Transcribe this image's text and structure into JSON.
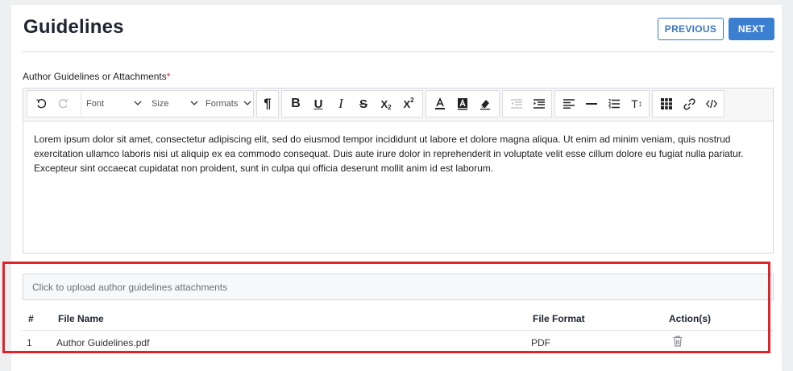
{
  "page": {
    "title": "Guidelines"
  },
  "nav": {
    "previous_label": "PREVIOUS",
    "next_label": "NEXT"
  },
  "field": {
    "label": "Author Guidelines or Attachments",
    "required_mark": "*"
  },
  "toolbar": {
    "font_select": "Font",
    "size_select": "Size",
    "formats_select": "Formats",
    "icons": [
      "undo-icon",
      "redo-icon",
      "paragraph-icon",
      "bold-icon",
      "underline-icon",
      "italic-icon",
      "strikethrough-icon",
      "subscript-icon",
      "superscript-icon",
      "font-color-icon",
      "highlight-color-icon",
      "eraser-icon",
      "outdent-icon",
      "indent-icon",
      "align-left-icon",
      "horizontal-rule-icon",
      "list-icon",
      "line-height-icon",
      "table-icon",
      "link-icon",
      "code-view-icon"
    ]
  },
  "editor": {
    "content": "Lorem ipsum dolor sit amet, consectetur adipiscing elit, sed do eiusmod tempor incididunt ut labore et dolore magna aliqua. Ut enim ad minim veniam, quis nostrud exercitation ullamco laboris nisi ut aliquip ex ea commodo consequat. Duis aute irure dolor in reprehenderit in voluptate velit esse cillum dolore eu fugiat nulla pariatur. Excepteur sint occaecat cupidatat non proident, sunt in culpa qui officia deserunt mollit anim id est laborum."
  },
  "upload": {
    "placeholder": "Click to upload author guidelines attachments"
  },
  "table": {
    "headers": {
      "index": "#",
      "file_name": "File Name",
      "file_format": "File Format",
      "actions": "Action(s)"
    },
    "rows": [
      {
        "index": "1",
        "file_name": "Author Guidelines.pdf",
        "file_format": "PDF",
        "action_icon": "trash-icon"
      }
    ]
  },
  "colors": {
    "primary": "#3a7fd0",
    "highlight": "#e0232a",
    "required": "#d9302c"
  }
}
